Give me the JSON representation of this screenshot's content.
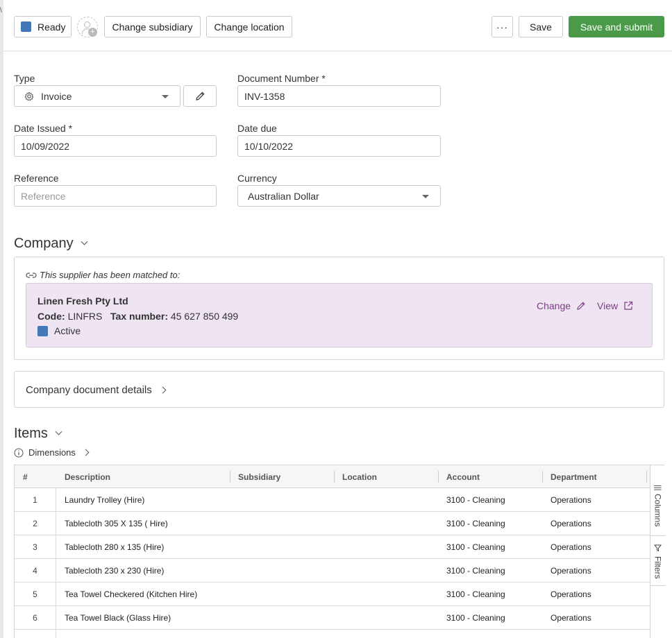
{
  "toolbar": {
    "status_label": "Ready",
    "status_color": "#4477b8",
    "change_subsidiary": "Change subsidiary",
    "change_location": "Change location",
    "more": "···",
    "save": "Save",
    "save_submit": "Save and submit",
    "submit_color": "#4a9a4a"
  },
  "form": {
    "type_label": "Type",
    "type_value": "Invoice",
    "doc_number_label": "Document Number *",
    "doc_number_value": "INV-1358",
    "date_issued_label": "Date Issued *",
    "date_issued_value": "10/09/2022",
    "date_due_label": "Date due",
    "date_due_value": "10/10/2022",
    "reference_label": "Reference",
    "reference_placeholder": "Reference",
    "currency_label": "Currency",
    "currency_value": "Australian Dollar"
  },
  "company": {
    "title": "Company",
    "matched_text": "This supplier has been matched to:",
    "supplier_name": "Linen Fresh Pty Ltd",
    "code_label": "Code:",
    "code_value": "LINFRS",
    "tax_label": "Tax number:",
    "tax_value": "45 627 850 499",
    "status": "Active",
    "status_color": "#4477b8",
    "change_link": "Change",
    "view_link": "View",
    "card_color": "#efe4f1",
    "link_color": "#7a3f84"
  },
  "company_details": {
    "title": "Company document details"
  },
  "items": {
    "title": "Items",
    "dimensions_label": "Dimensions",
    "columns": [
      "#",
      "Description",
      "Subsidiary",
      "Location",
      "Account",
      "Department"
    ],
    "rows": [
      {
        "num": "1",
        "description": "Laundry Trolley (Hire)",
        "subsidiary": "",
        "location": "",
        "account": "3100 - Cleaning",
        "department": "Operations"
      },
      {
        "num": "2",
        "description": "Tablecloth 305 X 135 ( Hire)",
        "subsidiary": "",
        "location": "",
        "account": "3100 - Cleaning",
        "department": "Operations"
      },
      {
        "num": "3",
        "description": "Tablecloth 280 x 135 (Hire)",
        "subsidiary": "",
        "location": "",
        "account": "3100 - Cleaning",
        "department": "Operations"
      },
      {
        "num": "4",
        "description": "Tablecloth 230 x 230 (Hire)",
        "subsidiary": "",
        "location": "",
        "account": "3100 - Cleaning",
        "department": "Operations"
      },
      {
        "num": "5",
        "description": "Tea Towel Checkered (Kitchen Hire)",
        "subsidiary": "",
        "location": "",
        "account": "3100 - Cleaning",
        "department": "Operations"
      },
      {
        "num": "6",
        "description": "Tea Towel Black (Glass Hire)",
        "subsidiary": "",
        "location": "",
        "account": "3100 - Cleaning",
        "department": "Operations"
      }
    ],
    "side_columns": "Columns",
    "side_filters": "Filters"
  }
}
